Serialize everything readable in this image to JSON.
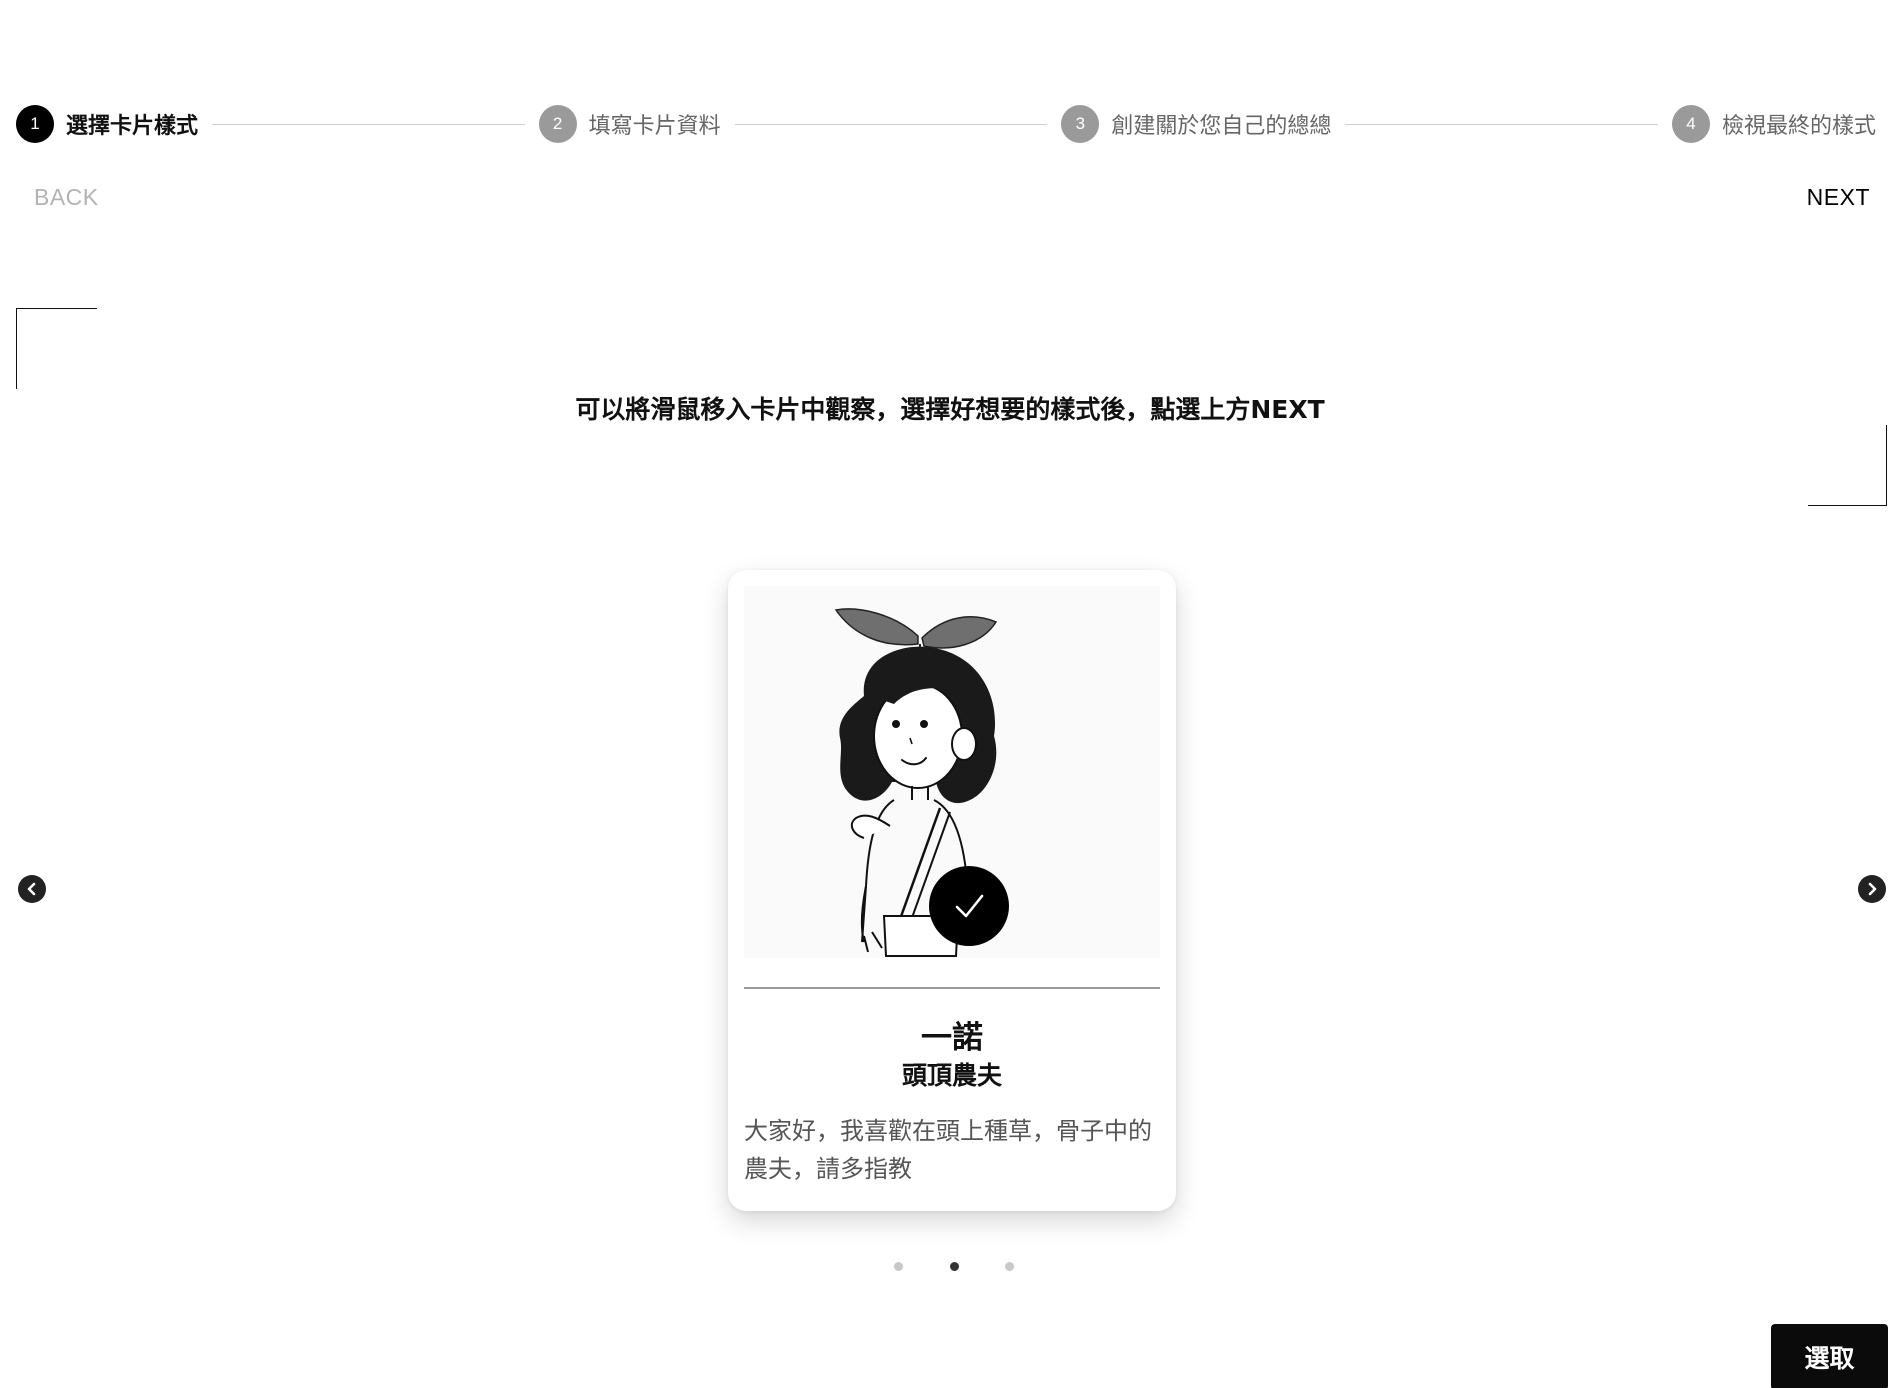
{
  "stepper": {
    "steps": [
      {
        "number": "1",
        "label": "選擇卡片樣式",
        "active": true
      },
      {
        "number": "2",
        "label": "填寫卡片資料",
        "active": false
      },
      {
        "number": "3",
        "label": "創建關於您自己的總總",
        "active": false
      },
      {
        "number": "4",
        "label": "檢視最終的樣式",
        "active": false
      }
    ]
  },
  "nav": {
    "back_label": "BACK",
    "next_label": "NEXT"
  },
  "instruction": "可以將滑鼠移入卡片中觀察，選擇好想要的樣式後，點選上方NEXT",
  "card": {
    "name": "一諾",
    "title": "頭頂農夫",
    "description": "大家好，我喜歡在頭上種草，骨子中的農夫，請多指教",
    "selected": true,
    "image_icon": "girl-with-sprout-illustration"
  },
  "carousel": {
    "dot_count": 3,
    "active_index": 1,
    "prev_icon": "chevron-left-icon",
    "next_icon": "chevron-right-icon"
  },
  "select_button_label": "選取",
  "colors": {
    "accent": "#000000",
    "inactive_step": "#9a9a9a",
    "back_disabled": "#b3b3b3"
  }
}
